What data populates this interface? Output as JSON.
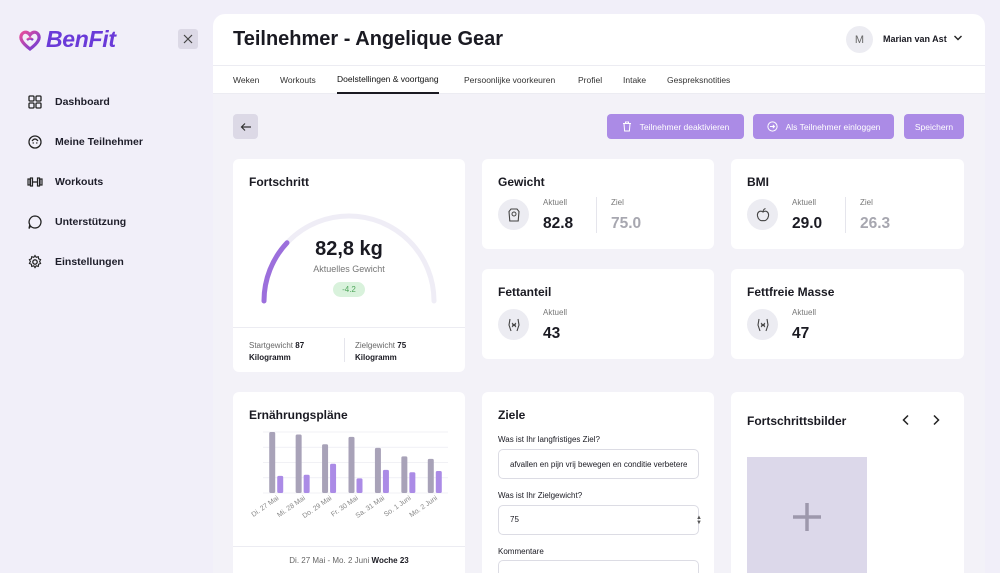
{
  "app": {
    "name": "BenFit"
  },
  "sidebar": {
    "items": [
      {
        "label": "Dashboard",
        "icon": "grid-icon"
      },
      {
        "label": "Meine Teilnehmer",
        "icon": "person-head-icon"
      },
      {
        "label": "Workouts",
        "icon": "dumbbell-icon"
      },
      {
        "label": "Unterstützung",
        "icon": "chat-bubble-icon"
      },
      {
        "label": "Einstellungen",
        "icon": "gear-icon"
      }
    ]
  },
  "header": {
    "title": "Teilnehmer - Angelique Gear",
    "user_initial": "M",
    "user_name": "Marian van Ast"
  },
  "tabs": [
    {
      "label": "Weken"
    },
    {
      "label": "Workouts"
    },
    {
      "label": "Doelstellingen & voortgang",
      "active": true
    },
    {
      "label": "Persoonlijke voorkeuren"
    },
    {
      "label": "Profiel"
    },
    {
      "label": "Intake"
    },
    {
      "label": "Gespreksnotities"
    }
  ],
  "actions": {
    "deactivate": "Teilnehmer deaktivieren",
    "login_as": "Als Teilnehmer einloggen",
    "save": "Speichern"
  },
  "progress": {
    "title": "Fortschritt",
    "current_value": "82,8 kg",
    "current_label": "Aktuelles Gewicht",
    "change": "-4.2",
    "gauge_fill_fraction": 0.24,
    "start_label": "Startgewicht",
    "start_value": "87",
    "goal_label": "Zielgewicht",
    "goal_value": "75",
    "unit": "Kilogramm"
  },
  "stats": {
    "weight": {
      "title": "Gewicht",
      "current_label": "Aktuell",
      "current": "82.8",
      "goal_label": "Ziel",
      "goal": "75.0"
    },
    "bmi": {
      "title": "BMI",
      "current_label": "Aktuell",
      "current": "29.0",
      "goal_label": "Ziel",
      "goal": "26.3"
    },
    "fat": {
      "title": "Fettanteil",
      "current_label": "Aktuell",
      "current": "43"
    },
    "lean": {
      "title": "Fettfreie Masse",
      "current_label": "Aktuell",
      "current": "47"
    }
  },
  "nutrition": {
    "title": "Ernährungspläne",
    "footer_range": "Di. 27 Mai - Mo. 2 Juni",
    "footer_week": "Woche 23"
  },
  "chart_data": {
    "type": "bar",
    "categories": [
      "Di. 27 Mai",
      "Mi. 28 Mai",
      "Do. 29 Mai",
      "Fr. 30 Mai",
      "Sa. 31 Mai",
      "So. 1 Juni",
      "Mo. 2 Juni"
    ],
    "series": [
      {
        "values": [
          100,
          96,
          80,
          92,
          74,
          60,
          56
        ],
        "color": "#a8a2b8"
      },
      {
        "values": [
          28,
          30,
          48,
          24,
          38,
          34,
          36
        ],
        "color": "#ab8be6"
      }
    ],
    "ylim": [
      0,
      100
    ],
    "grid": true
  },
  "goals": {
    "title": "Ziele",
    "q1": "Was ist Ihr langfristiges Ziel?",
    "a1": "afvallen en pijn vrij bewegen en conditie verbeteren",
    "q2": "Was ist Ihr Zielgewicht?",
    "a2": "75",
    "q3": "Kommentare"
  },
  "photos": {
    "title": "Fortschrittsbilder"
  },
  "colors": {
    "accent": "#ab8be6",
    "brand": "#6a3ad8",
    "background": "#f1eff9"
  }
}
